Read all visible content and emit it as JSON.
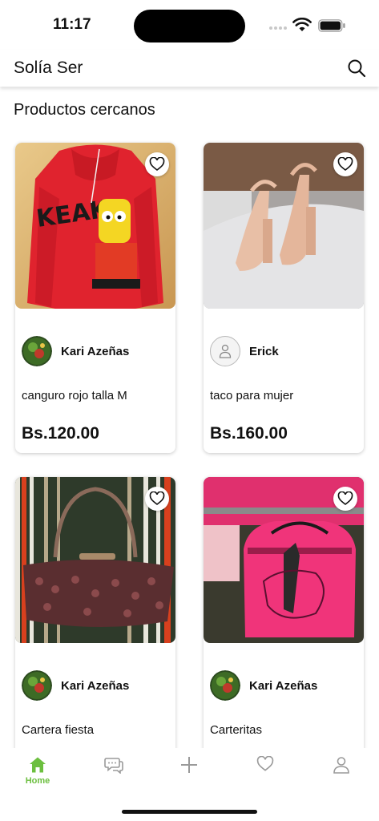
{
  "status_bar": {
    "time": "11:17"
  },
  "header": {
    "title": "Solía Ser",
    "search_icon": "search-icon"
  },
  "section": {
    "title": "Productos cercanos"
  },
  "products": [
    {
      "seller": "Kari Azeñas",
      "name": "canguro rojo talla M",
      "price": "Bs.120.00",
      "image": "red-hoodie-photo"
    },
    {
      "seller": "Erick",
      "name": "taco para mujer",
      "price": "Bs.160.00",
      "image": "beige-heels-photo"
    },
    {
      "seller": "Kari Azeñas",
      "name": "Cartera fiesta",
      "price": "",
      "image": "sequin-purse-photo"
    },
    {
      "seller": "Kari Azeñas",
      "name": "Carteritas",
      "price": "",
      "image": "pink-bags-photo"
    }
  ],
  "bottom_nav": {
    "items": [
      {
        "label": "Home",
        "icon": "home-icon",
        "active": true
      },
      {
        "label": "",
        "icon": "chat-icon",
        "active": false
      },
      {
        "label": "",
        "icon": "plus-icon",
        "active": false
      },
      {
        "label": "",
        "icon": "heart-icon",
        "active": false
      },
      {
        "label": "",
        "icon": "profile-icon",
        "active": false
      }
    ]
  },
  "colors": {
    "accent": "#6cbf3f",
    "text": "#111111",
    "inactive_icon": "#9a9a9a"
  }
}
